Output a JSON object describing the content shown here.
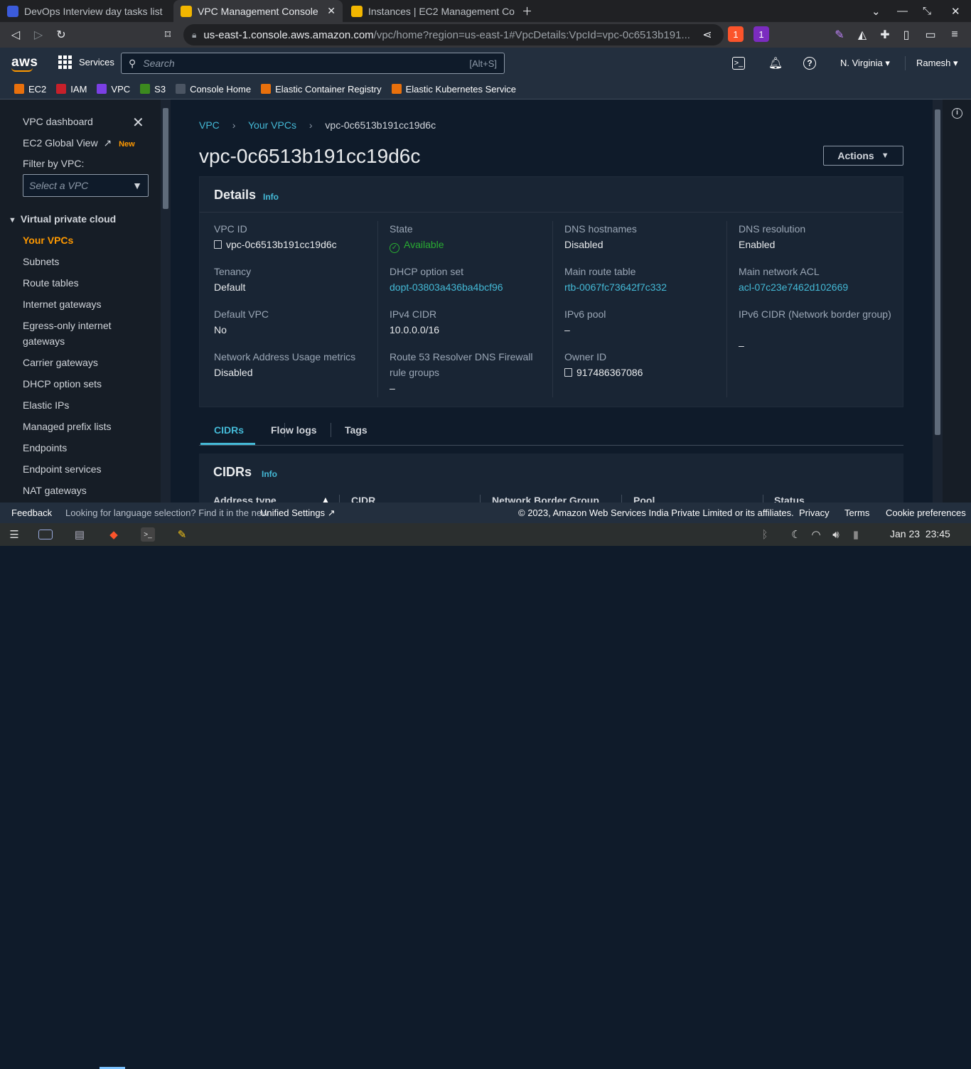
{
  "browser": {
    "tabs": [
      {
        "title": "DevOps Interview day tasks list",
        "active": false
      },
      {
        "title": "VPC Management Console",
        "active": true
      },
      {
        "title": "Instances | EC2 Management Co",
        "active": false
      }
    ],
    "url_host": "us-east-1.console.aws.amazon.com",
    "url_path": "/vpc/home?region=us-east-1#VpcDetails:VpcId=vpc-0c6513b191...",
    "brave_badge": "1",
    "alert_badge": "1"
  },
  "aws_header": {
    "logo": "aws",
    "services_label": "Services",
    "search_placeholder": "Search",
    "search_shortcut": "[Alt+S]",
    "region": "N. Virginia",
    "user": "Ramesh"
  },
  "favorites": [
    {
      "label": "EC2",
      "color": "#e8700c"
    },
    {
      "label": "IAM",
      "color": "#c7202a"
    },
    {
      "label": "VPC",
      "color": "#7b3fe4"
    },
    {
      "label": "S3",
      "color": "#3c8a1e"
    },
    {
      "label": "Console Home",
      "color": "#4b5563"
    },
    {
      "label": "Elastic Container Registry",
      "color": "#e8700c"
    },
    {
      "label": "Elastic Kubernetes Service",
      "color": "#e8700c"
    }
  ],
  "sidebar": {
    "dashboard": "VPC dashboard",
    "global_view": "EC2 Global View",
    "new_badge": "New",
    "filter_label": "Filter by VPC:",
    "filter_placeholder": "Select a VPC",
    "section": "Virtual private cloud",
    "items": [
      "Your VPCs",
      "Subnets",
      "Route tables",
      "Internet gateways",
      "Egress-only internet gateways",
      "Carrier gateways",
      "DHCP option sets",
      "Elastic IPs",
      "Managed prefix lists",
      "Endpoints",
      "Endpoint services",
      "NAT gateways"
    ]
  },
  "main": {
    "breadcrumb": [
      "VPC",
      "Your VPCs",
      "vpc-0c6513b191cc19d6c"
    ],
    "title": "vpc-0c6513b191cc19d6c",
    "actions_label": "Actions",
    "details_title": "Details",
    "info": "Info",
    "details": {
      "col1": [
        {
          "label": "VPC ID",
          "value": "vpc-0c6513b191cc19d6c"
        },
        {
          "label": "Tenancy",
          "value": "Default"
        },
        {
          "label": "Default VPC",
          "value": "No"
        },
        {
          "label": "Network Address Usage metrics",
          "value": "Disabled"
        }
      ],
      "col2": [
        {
          "label": "State",
          "value": "Available"
        },
        {
          "label": "DHCP option set",
          "value": "dopt-03803a436ba4bcf96"
        },
        {
          "label": "IPv4 CIDR",
          "value": "10.0.0.0/16"
        },
        {
          "label": "Route 53 Resolver DNS Firewall rule groups",
          "value": "–"
        }
      ],
      "col3": [
        {
          "label": "DNS hostnames",
          "value": "Disabled"
        },
        {
          "label": "Main route table",
          "value": "rtb-0067fc73642f7c332"
        },
        {
          "label": "IPv6 pool",
          "value": "–"
        },
        {
          "label": "Owner ID",
          "value": "917486367086"
        }
      ],
      "col4": [
        {
          "label": "DNS resolution",
          "value": "Enabled"
        },
        {
          "label": "Main network ACL",
          "value": "acl-07c23e7462d102669"
        },
        {
          "label": "IPv6 CIDR (Network border group)",
          "value": "–"
        }
      ]
    },
    "tabs": [
      "CIDRs",
      "Flow logs",
      "Tags"
    ],
    "cidrs_title": "CIDRs",
    "cidr_columns": [
      "Address type",
      "CIDR",
      "Network Border Group",
      "Pool",
      "Status"
    ]
  },
  "footer": {
    "feedback": "Feedback",
    "lang_text": "Looking for language selection? Find it in the new",
    "unified": "Unified Settings",
    "copyright": "© 2023, Amazon Web Services India Private Limited or its affiliates.",
    "privacy": "Privacy",
    "terms": "Terms",
    "cookies": "Cookie preferences"
  },
  "taskbar": {
    "clock": "Jan 23  23:45"
  },
  "colors": {
    "accent": "#44b9d6",
    "active_nav": "#ff9900",
    "success": "#29ad32"
  }
}
